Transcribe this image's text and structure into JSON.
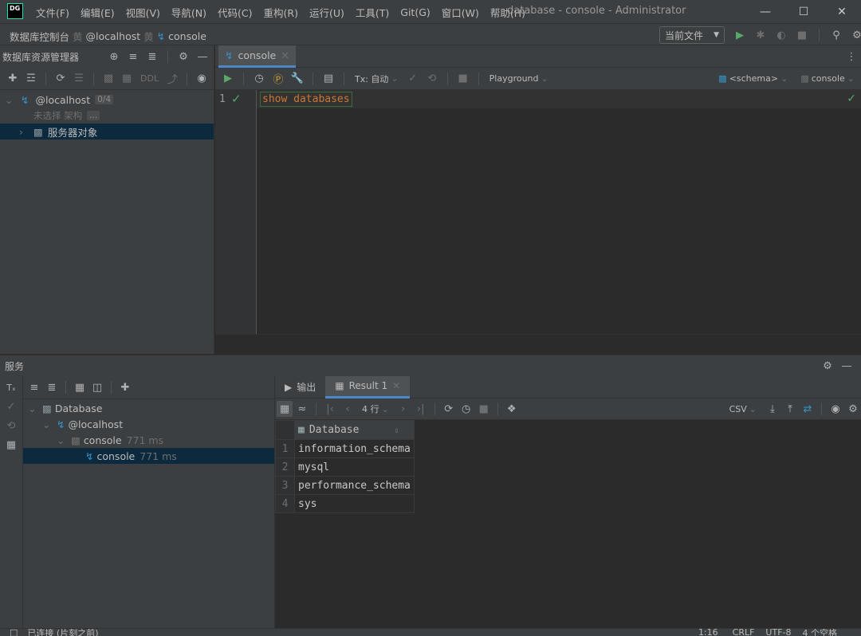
{
  "menu": [
    "文件(F)",
    "编辑(E)",
    "视图(V)",
    "导航(N)",
    "代码(C)",
    "重构(R)",
    "运行(U)",
    "工具(T)",
    "Git(G)",
    "窗口(W)",
    "帮助(H)"
  ],
  "app_logo": "DG",
  "window_title": "database - console - Administrator",
  "breadcrumb": {
    "root": "数据库控制台",
    "host": "@localhost",
    "file": "console"
  },
  "current_file": "当前文件",
  "db_explorer": {
    "title": "数据库资源管理器",
    "ddl_label": "DDL",
    "host": "@localhost",
    "host_badge": "0/4",
    "no_schema": "未选择 架构",
    "ellipsis": "...",
    "server_objects": "服务器对象"
  },
  "editor": {
    "tab": "console",
    "tx_label": "Tx: 自动",
    "playground": "Playground",
    "schema": "<schema>",
    "console": "console",
    "line_no": "1",
    "code": "show databases"
  },
  "services": {
    "title": "服务",
    "tree": {
      "database": "Database",
      "host": "@localhost",
      "console_session": "console",
      "console_session_time": "771 ms",
      "console_query": "console",
      "console_query_time": "771 ms"
    }
  },
  "results": {
    "tab_output": "输出",
    "tab_result": "Result 1",
    "rows_label": "4 行",
    "export": "CSV",
    "column": "Database",
    "rows": [
      "information_schema",
      "mysql",
      "performance_schema",
      "sys"
    ]
  },
  "status": {
    "left": "已连接 (片刻之前)",
    "position": "1:16",
    "line_sep": "CRLF",
    "encoding": "UTF-8",
    "indent": "4 个空格"
  }
}
